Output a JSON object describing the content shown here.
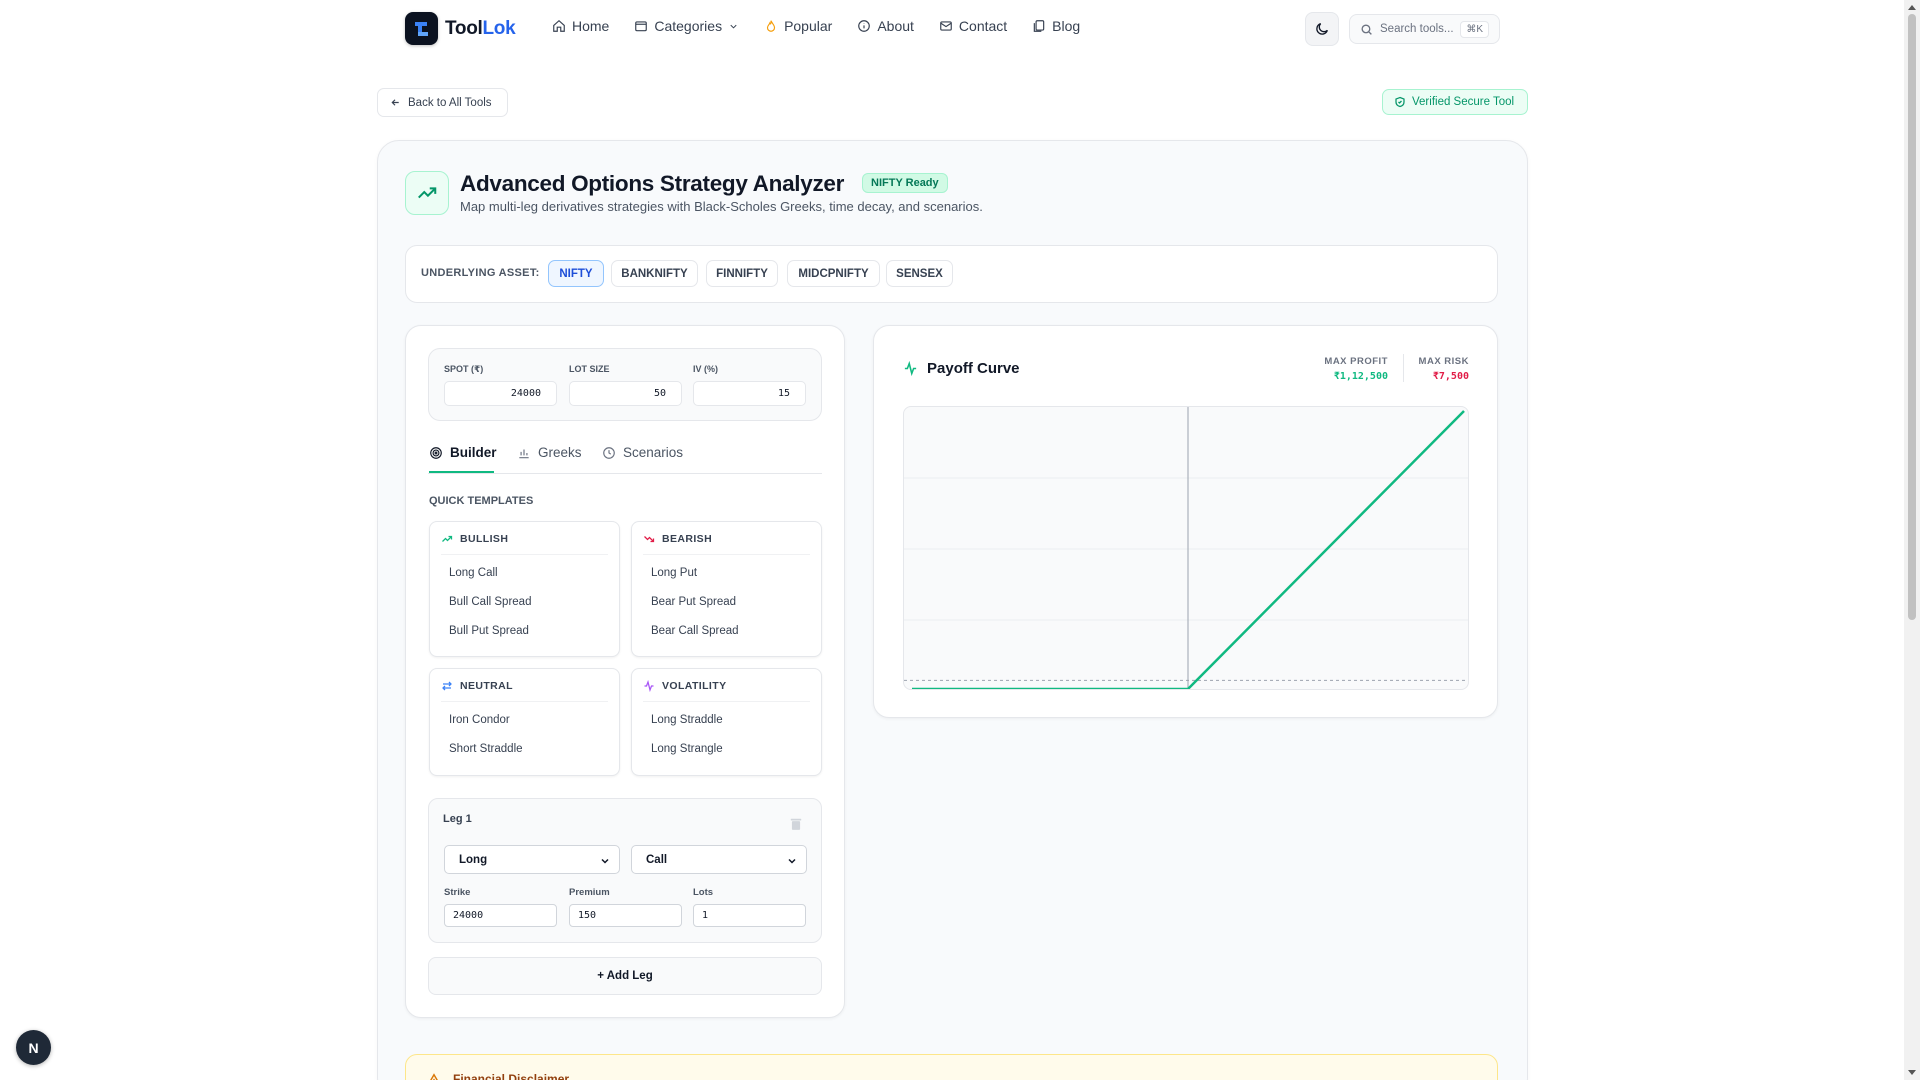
{
  "header": {
    "logo_text_part1": "Tool",
    "logo_text_part2": "Lok",
    "nav": [
      {
        "label": "Home",
        "icon": "home-icon"
      },
      {
        "label": "Categories",
        "icon": "folder-icon"
      },
      {
        "label": "Popular",
        "icon": "flame-icon"
      },
      {
        "label": "About",
        "icon": "info-icon"
      },
      {
        "label": "Contact",
        "icon": "mail-icon"
      },
      {
        "label": "Blog",
        "icon": "blog-icon"
      }
    ],
    "search_placeholder": "Search tools...",
    "search_shortcut": "⌘K"
  },
  "back_label": "Back to All Tools",
  "verified_label": "Verified Secure Tool",
  "tool": {
    "title": "Advanced Options Strategy Analyzer",
    "badge": "NIFTY Ready",
    "subtitle": "Map multi-leg derivatives strategies with Black-Scholes Greeks, time decay, and scenarios."
  },
  "assets": {
    "label": "UNDERLYING ASSET:",
    "options": [
      "NIFTY",
      "BANKNIFTY",
      "FINNIFTY",
      "MIDCPNIFTY",
      "SENSEX"
    ],
    "selected": "NIFTY"
  },
  "params": {
    "spot_label": "SPOT (₹)",
    "spot": "24000",
    "lot_label": "LOT SIZE",
    "lot": "50",
    "iv_label": "IV (%)",
    "iv": "15"
  },
  "tabs": [
    {
      "label": "Builder",
      "active": true
    },
    {
      "label": "Greeks",
      "active": false
    },
    {
      "label": "Scenarios",
      "active": false
    }
  ],
  "templates": {
    "label": "QUICK TEMPLATES",
    "groups": [
      {
        "name": "BULLISH",
        "color": "#10b981",
        "items": [
          "Long Call",
          "Bull Call Spread",
          "Bull Put Spread"
        ]
      },
      {
        "name": "BEARISH",
        "color": "#e11d48",
        "items": [
          "Long Put",
          "Bear Put Spread",
          "Bear Call Spread"
        ]
      },
      {
        "name": "NEUTRAL",
        "color": "#3b82f6",
        "items": [
          "Iron Condor",
          "Short Straddle"
        ]
      },
      {
        "name": "VOLATILITY",
        "color": "#a855f7",
        "items": [
          "Long Straddle",
          "Long Strangle"
        ]
      }
    ]
  },
  "leg": {
    "title": "Leg 1",
    "direction": "Long",
    "option_type": "Call",
    "strike_label": "Strike",
    "strike": "24000",
    "premium_label": "Premium",
    "premium": "150",
    "lots_label": "Lots",
    "lots": "1"
  },
  "add_leg_label": "+ Add Leg",
  "payoff": {
    "title": "Payoff Curve",
    "max_profit_label": "MAX PROFIT",
    "max_profit": "₹1,12,500",
    "max_risk_label": "MAX RISK",
    "max_risk": "₹7,500"
  },
  "chart_data": {
    "type": "line",
    "title": "Payoff Curve",
    "series": [
      {
        "x": [
          19200,
          24000,
          28800
        ],
        "y": [
          -7500,
          -7500,
          232500
        ]
      }
    ],
    "xlim": [
      19200,
      28800
    ],
    "ylim": [
      -7500,
      232500
    ],
    "reference_lines": {
      "spot_x": 24000,
      "zero_y": 0
    },
    "grid": true,
    "line_color": "#10b981"
  },
  "disclaimer_title": "Financial Disclaimer",
  "next_badge": "N",
  "colors": {
    "accent_green": "#10b981",
    "accent_blue": "#2563eb",
    "risk_red": "#e11d48"
  }
}
